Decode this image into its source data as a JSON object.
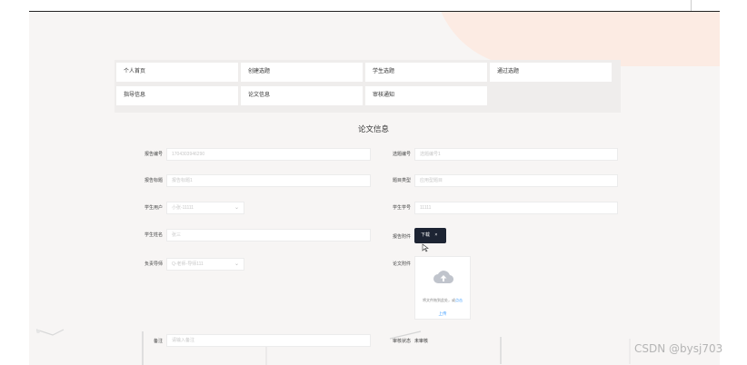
{
  "nav": {
    "row1": [
      "个人首页",
      "创建选题",
      "学生选题",
      "通过选题"
    ],
    "row2": [
      "指导信息",
      "论文信息",
      "审核通知"
    ]
  },
  "page_title": "论文信息",
  "form": {
    "report_id": {
      "label": "报告编号",
      "value": "1704303946290"
    },
    "topic_id": {
      "label": "选题编号",
      "placeholder": "选题编号1"
    },
    "report_title": {
      "label": "报告标题",
      "placeholder": "报告标题1"
    },
    "topic_type": {
      "label": "题目类型",
      "placeholder": "应用型题目"
    },
    "student_user": {
      "label": "学生用户",
      "value": "小张-11111"
    },
    "student_no": {
      "label": "学生学号",
      "value": "11111"
    },
    "student_name": {
      "label": "学生姓名",
      "value": "张三"
    },
    "report_attachment": {
      "label": "报告附件"
    },
    "teacher": {
      "label": "负责导师",
      "value": "Q-老师-导师111"
    },
    "paper_attachment": {
      "label": "论文附件"
    },
    "remark": {
      "label": "备注",
      "placeholder": "请输入备注"
    },
    "review_status": {
      "label": "审核状态",
      "value": "未审核"
    }
  },
  "tooltip": {
    "label": "下载"
  },
  "upload": {
    "hint": "将文件拖到此处，或",
    "hint_link": "点击",
    "link": "上传"
  },
  "watermark": "CSDN @bysj703"
}
